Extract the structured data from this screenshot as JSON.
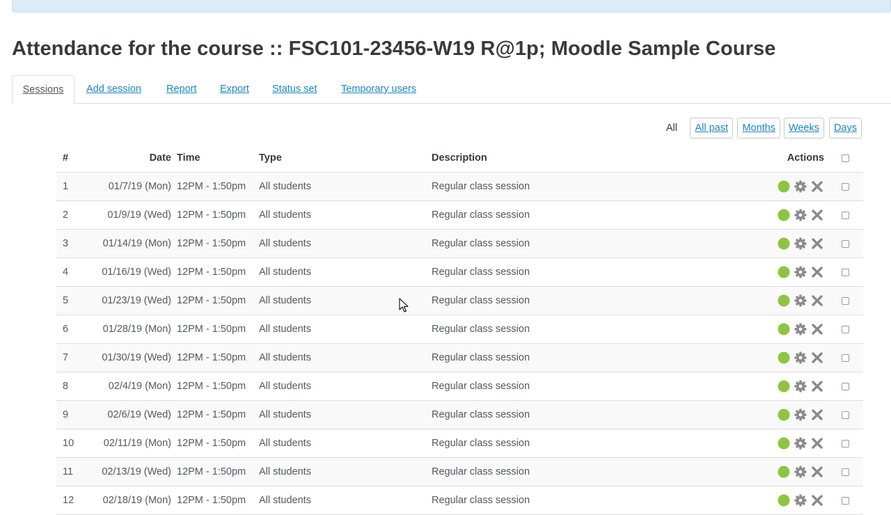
{
  "page_title": "Attendance for the course :: FSC101-23456-W19 R@1p; Moodle Sample Course",
  "tabs": [
    {
      "label": "Sessions",
      "active": true
    },
    {
      "label": "Add session"
    },
    {
      "label": "Report"
    },
    {
      "label": "Export"
    },
    {
      "label": "Status set"
    },
    {
      "label": "Temporary users"
    }
  ],
  "view_filter": {
    "current": "All",
    "buttons": [
      "All past",
      "Months",
      "Weeks",
      "Days"
    ]
  },
  "table": {
    "headers": {
      "num": "#",
      "date": "Date",
      "time": "Time",
      "type": "Type",
      "description": "Description",
      "actions": "Actions"
    },
    "rows": [
      {
        "num": "1",
        "date": "01/7/19 (Mon)",
        "time": "12PM - 1:50pm",
        "type": "All students",
        "description": "Regular class session"
      },
      {
        "num": "2",
        "date": "01/9/19 (Wed)",
        "time": "12PM - 1:50pm",
        "type": "All students",
        "description": "Regular class session"
      },
      {
        "num": "3",
        "date": "01/14/19 (Mon)",
        "time": "12PM - 1:50pm",
        "type": "All students",
        "description": "Regular class session"
      },
      {
        "num": "4",
        "date": "01/16/19 (Wed)",
        "time": "12PM - 1:50pm",
        "type": "All students",
        "description": "Regular class session"
      },
      {
        "num": "5",
        "date": "01/23/19 (Wed)",
        "time": "12PM - 1:50pm",
        "type": "All students",
        "description": "Regular class session"
      },
      {
        "num": "6",
        "date": "01/28/19 (Mon)",
        "time": "12PM - 1:50pm",
        "type": "All students",
        "description": "Regular class session"
      },
      {
        "num": "7",
        "date": "01/30/19 (Wed)",
        "time": "12PM - 1:50pm",
        "type": "All students",
        "description": "Regular class session"
      },
      {
        "num": "8",
        "date": "02/4/19 (Mon)",
        "time": "12PM - 1:50pm",
        "type": "All students",
        "description": "Regular class session"
      },
      {
        "num": "9",
        "date": "02/6/19 (Wed)",
        "time": "12PM - 1:50pm",
        "type": "All students",
        "description": "Regular class session"
      },
      {
        "num": "10",
        "date": "02/11/19 (Mon)",
        "time": "12PM - 1:50pm",
        "type": "All students",
        "description": "Regular class session"
      },
      {
        "num": "11",
        "date": "02/13/19 (Wed)",
        "time": "12PM - 1:50pm",
        "type": "All students",
        "description": "Regular class session"
      },
      {
        "num": "12",
        "date": "02/18/19 (Mon)",
        "time": "12PM - 1:50pm",
        "type": "All students",
        "description": "Regular class session"
      }
    ],
    "row_actions": [
      "take-attendance-icon",
      "gear-icon",
      "close-icon"
    ]
  },
  "colors": {
    "link": "#1a87c9",
    "take_attendance": "#8cc63f",
    "action_icon_gray": "#8a8a8a",
    "banner": "#dcebf5"
  }
}
